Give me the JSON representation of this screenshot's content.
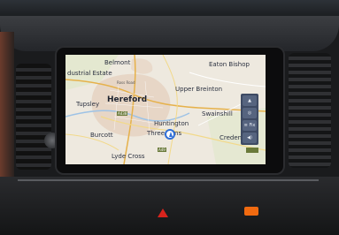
{
  "map": {
    "places": {
      "eaton_bishop": "Eaton Bishop",
      "belmont": "Belmont",
      "industrial_estate": "dustrial Estate",
      "hereford": "Hereford",
      "upper_breinton": "Upper Breinton",
      "tupsley": "Tupsley",
      "swainshill": "Swainshill",
      "huntington": "Huntington",
      "burcott": "Burcott",
      "three_elms": "Three Elms",
      "credenhill": "Creden",
      "lyde_cross": "Lyde Cross"
    },
    "roads": {
      "ross_road": "Ross Road",
      "a438": "A438",
      "a49": "A49"
    }
  },
  "controls": {
    "zoom_icon": "mountain-icon",
    "compass_icon": "compass-icon",
    "traffic": "≡ Fix",
    "sound_icon": "speaker-icon"
  }
}
